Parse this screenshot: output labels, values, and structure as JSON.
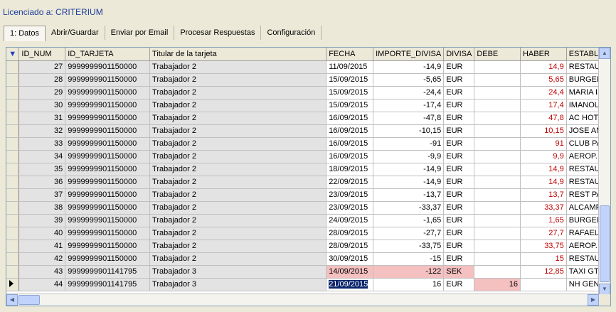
{
  "license_text": "Licenciado a: CRITERIUM",
  "tabs": [
    {
      "label": "1: Datos"
    },
    {
      "label": "Abrir/Guardar"
    },
    {
      "label": "Enviar por Email"
    },
    {
      "label": "Procesar Respuestas"
    },
    {
      "label": "Configuración"
    }
  ],
  "grid": {
    "indicator_glyph": "▼",
    "columns": [
      "ID_NUM",
      "ID_TARJETA",
      "Titular de la tarjeta",
      "FECHA",
      "IMPORTE_DIVISA",
      "DIVISA",
      "DEBE",
      "HABER",
      "ESTABLE"
    ],
    "rows": [
      {
        "id": "27",
        "tarjeta": "9999999901150000",
        "titular": "Trabajador 2",
        "fecha": "11/09/2015",
        "importe": "-14,9",
        "divisa": "EUR",
        "debe": "",
        "haber": "14,9",
        "estable": "RESTAUR"
      },
      {
        "id": "28",
        "tarjeta": "9999999901150000",
        "titular": "Trabajador 2",
        "fecha": "15/09/2015",
        "importe": "-5,65",
        "divisa": "EUR",
        "debe": "",
        "haber": "5,65",
        "estable": "BURGER"
      },
      {
        "id": "29",
        "tarjeta": "9999999901150000",
        "titular": "Trabajador 2",
        "fecha": "15/09/2015",
        "importe": "-24,4",
        "divisa": "EUR",
        "debe": "",
        "haber": "24,4",
        "estable": "MARIA IS"
      },
      {
        "id": "30",
        "tarjeta": "9999999901150000",
        "titular": "Trabajador 2",
        "fecha": "15/09/2015",
        "importe": "-17,4",
        "divisa": "EUR",
        "debe": "",
        "haber": "17,4",
        "estable": "IMANOL"
      },
      {
        "id": "31",
        "tarjeta": "9999999901150000",
        "titular": "Trabajador 2",
        "fecha": "16/09/2015",
        "importe": "-47,8",
        "divisa": "EUR",
        "debe": "",
        "haber": "47,8",
        "estable": "AC HOTE"
      },
      {
        "id": "32",
        "tarjeta": "9999999901150000",
        "titular": "Trabajador 2",
        "fecha": "16/09/2015",
        "importe": "-10,15",
        "divisa": "EUR",
        "debe": "",
        "haber": "10,15",
        "estable": "JOSE ANT"
      },
      {
        "id": "33",
        "tarjeta": "9999999901150000",
        "titular": "Trabajador 2",
        "fecha": "16/09/2015",
        "importe": "-91",
        "divisa": "EUR",
        "debe": "",
        "haber": "91",
        "estable": "CLUB PAD"
      },
      {
        "id": "34",
        "tarjeta": "9999999901150000",
        "titular": "Trabajador 2",
        "fecha": "16/09/2015",
        "importe": "-9,9",
        "divisa": "EUR",
        "debe": "",
        "haber": "9,9",
        "estable": "AEROP. A"
      },
      {
        "id": "35",
        "tarjeta": "9999999901150000",
        "titular": "Trabajador 2",
        "fecha": "18/09/2015",
        "importe": "-14,9",
        "divisa": "EUR",
        "debe": "",
        "haber": "14,9",
        "estable": "RESTAUR"
      },
      {
        "id": "36",
        "tarjeta": "9999999901150000",
        "titular": "Trabajador 2",
        "fecha": "22/09/2015",
        "importe": "-14,9",
        "divisa": "EUR",
        "debe": "",
        "haber": "14,9",
        "estable": "RESTAUR"
      },
      {
        "id": "37",
        "tarjeta": "9999999901150000",
        "titular": "Trabajador 2",
        "fecha": "23/09/2015",
        "importe": "-13,7",
        "divisa": "EUR",
        "debe": "",
        "haber": "13,7",
        "estable": "REST PAR"
      },
      {
        "id": "38",
        "tarjeta": "9999999901150000",
        "titular": "Trabajador 2",
        "fecha": "23/09/2015",
        "importe": "-33,37",
        "divisa": "EUR",
        "debe": "",
        "haber": "33,37",
        "estable": "ALCAMPO"
      },
      {
        "id": "39",
        "tarjeta": "9999999901150000",
        "titular": "Trabajador 2",
        "fecha": "24/09/2015",
        "importe": "-1,65",
        "divisa": "EUR",
        "debe": "",
        "haber": "1,65",
        "estable": "BURGER"
      },
      {
        "id": "40",
        "tarjeta": "9999999901150000",
        "titular": "Trabajador 2",
        "fecha": "28/09/2015",
        "importe": "-27,7",
        "divisa": "EUR",
        "debe": "",
        "haber": "27,7",
        "estable": "RAFAEL H"
      },
      {
        "id": "41",
        "tarjeta": "9999999901150000",
        "titular": "Trabajador 2",
        "fecha": "28/09/2015",
        "importe": "-33,75",
        "divisa": "EUR",
        "debe": "",
        "haber": "33,75",
        "estable": "AEROP. A"
      },
      {
        "id": "42",
        "tarjeta": "9999999901150000",
        "titular": "Trabajador 2",
        "fecha": "30/09/2015",
        "importe": "-15",
        "divisa": "EUR",
        "debe": "",
        "haber": "15",
        "estable": "RESTAUR"
      },
      {
        "id": "43",
        "tarjeta": "9999999901141795",
        "titular": "Trabajador 3",
        "fecha": "14/09/2015",
        "importe": "-122",
        "divisa": "SEK",
        "debe": "",
        "haber": "12,85",
        "estable": "TAXI GTE",
        "flag": "pink"
      },
      {
        "id": "44",
        "tarjeta": "9999999901141795",
        "titular": "Trabajador 3",
        "fecha": "21/09/2015",
        "importe": "16",
        "divisa": "EUR",
        "debe": "16",
        "haber": "",
        "estable": "NH GENT",
        "current": true
      }
    ]
  },
  "colors": {
    "haber_text": "#c00000",
    "highlight": "#f4c0c0",
    "selection": "#0a246a",
    "license_text": "#1f3f9f"
  }
}
